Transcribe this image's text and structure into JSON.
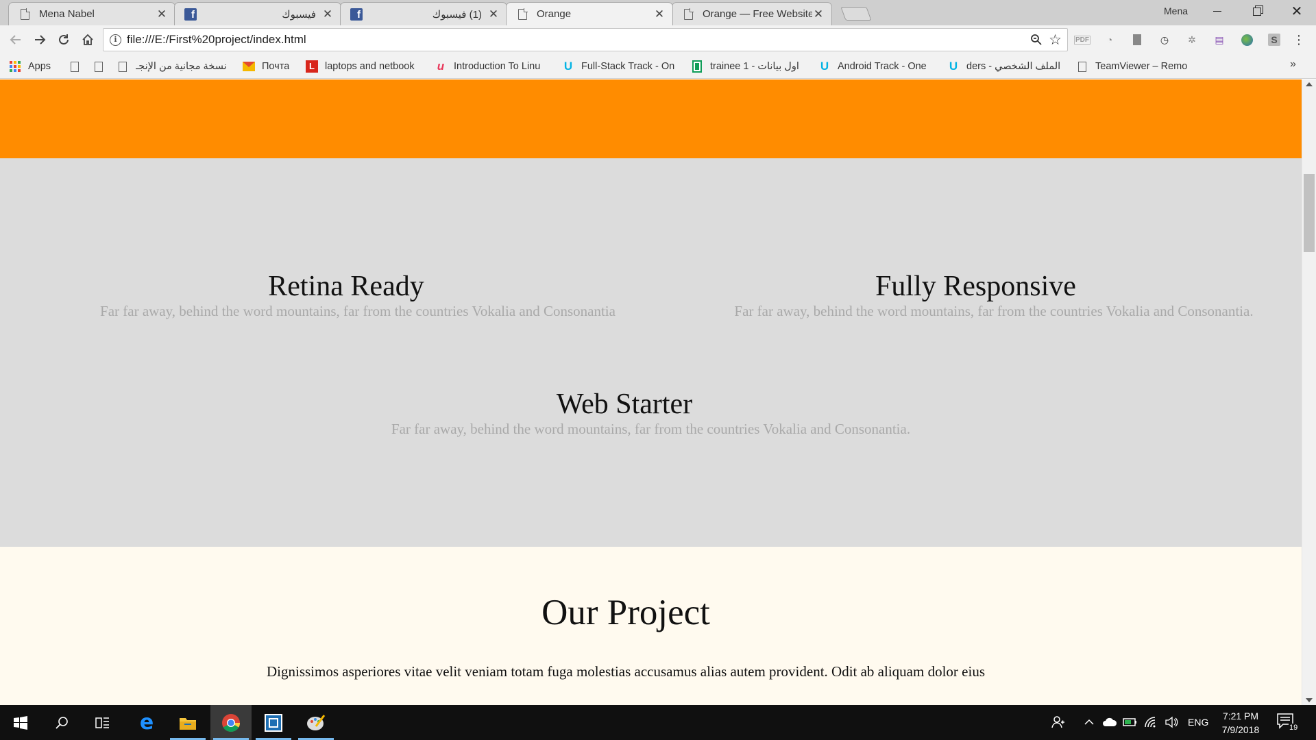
{
  "browser": {
    "tabs": [
      {
        "title": "Mena Nabel",
        "icon": "page-icon",
        "active": false
      },
      {
        "title": "فيسبوك",
        "icon": "facebook-icon",
        "active": false
      },
      {
        "title": "(1) فيسبوك",
        "icon": "facebook-icon",
        "active": false
      },
      {
        "title": "Orange",
        "icon": "page-icon",
        "active": true
      },
      {
        "title": "Orange — Free Website T",
        "icon": "page-icon",
        "active": false
      }
    ],
    "profile_name": "Mena",
    "address": "file:///E:/First%20project/index.html",
    "bookmarks": [
      {
        "label": "Apps",
        "icon": "apps-grid-icon"
      },
      {
        "label": "",
        "icon": "page-icon"
      },
      {
        "label": "",
        "icon": "page-icon"
      },
      {
        "label": "نسخة مجانية من الإنجـ",
        "icon": "page-icon"
      },
      {
        "label": "Почта",
        "icon": "mail-icon"
      },
      {
        "label": "laptops and netbook",
        "icon": "l-logo-icon"
      },
      {
        "label": "Introduction To Linu",
        "icon": "udemy-icon"
      },
      {
        "label": "Full-Stack Track - On",
        "icon": "udacity-icon"
      },
      {
        "label": "trainee 1 - اول بيانات",
        "icon": "sheets-icon"
      },
      {
        "label": "Android Track - One",
        "icon": "udacity-icon"
      },
      {
        "label": "الملف الشخصي - ders",
        "icon": "udacity-icon"
      },
      {
        "label": "TeamViewer – Remo",
        "icon": "page-icon"
      }
    ],
    "colors": {
      "tab_strip": "#cfcfcf",
      "toolbar": "#f2f2f2"
    }
  },
  "page": {
    "colors": {
      "header_band": "#ff8c00",
      "features_bg": "#dcdcdc",
      "project_bg": "#fffaef",
      "muted_text": "#a9a9a9"
    },
    "features": [
      {
        "title": "Retina Ready",
        "text": "Far far away, behind the word mountains, far from the countries Vokalia and Consonantia"
      },
      {
        "title": "Fully Responsive",
        "text": "Far far away, behind the word mountains, far from the countries Vokalia and Consonantia."
      },
      {
        "title": "Web Starter",
        "text": "Far far away, behind the word mountains, far from the countries Vokalia and Consonantia."
      }
    ],
    "project": {
      "heading": "Our Project",
      "text": "Dignissimos asperiores vitae velit veniam totam fuga molestias accusamus alias autem provident. Odit ab aliquam dolor eius"
    }
  },
  "taskbar": {
    "language": "ENG",
    "time": "7:21 PM",
    "date": "7/9/2018",
    "notification_count": "19"
  }
}
